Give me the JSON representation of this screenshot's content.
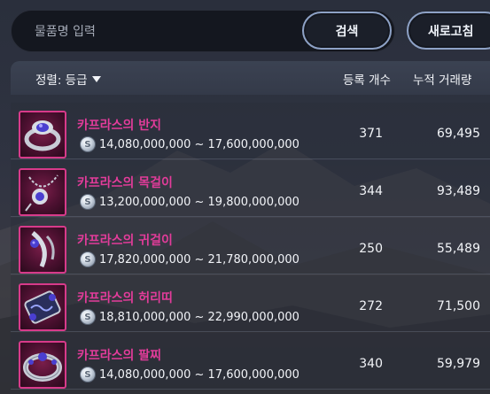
{
  "search": {
    "placeholder": "물품명 입력",
    "button_label": "검색",
    "refresh_label": "새로고침"
  },
  "header": {
    "sort_label": "정렬: 등급",
    "col_count": "등록 개수",
    "col_volume": "누적 거래량"
  },
  "colors": {
    "item_name": "#e23c9a",
    "thumb_border": "#d83a8a",
    "button_border": "#8ea2c6"
  },
  "items": [
    {
      "name": "카프라스의 반지",
      "price": "14,080,000,000 ~ 17,600,000,000",
      "count": "371",
      "volume": "69,495",
      "icon": "ring-icon"
    },
    {
      "name": "카프라스의 목걸이",
      "price": "13,200,000,000 ~ 19,800,000,000",
      "count": "344",
      "volume": "93,489",
      "icon": "necklace-icon"
    },
    {
      "name": "카프라스의 귀걸이",
      "price": "17,820,000,000 ~ 21,780,000,000",
      "count": "250",
      "volume": "55,489",
      "icon": "earring-icon"
    },
    {
      "name": "카프라스의 허리띠",
      "price": "18,810,000,000 ~ 22,990,000,000",
      "count": "272",
      "volume": "71,500",
      "icon": "belt-icon"
    },
    {
      "name": "카프라스의 팔찌",
      "price": "14,080,000,000 ~ 17,600,000,000",
      "count": "340",
      "volume": "59,979",
      "icon": "bracelet-icon"
    }
  ]
}
